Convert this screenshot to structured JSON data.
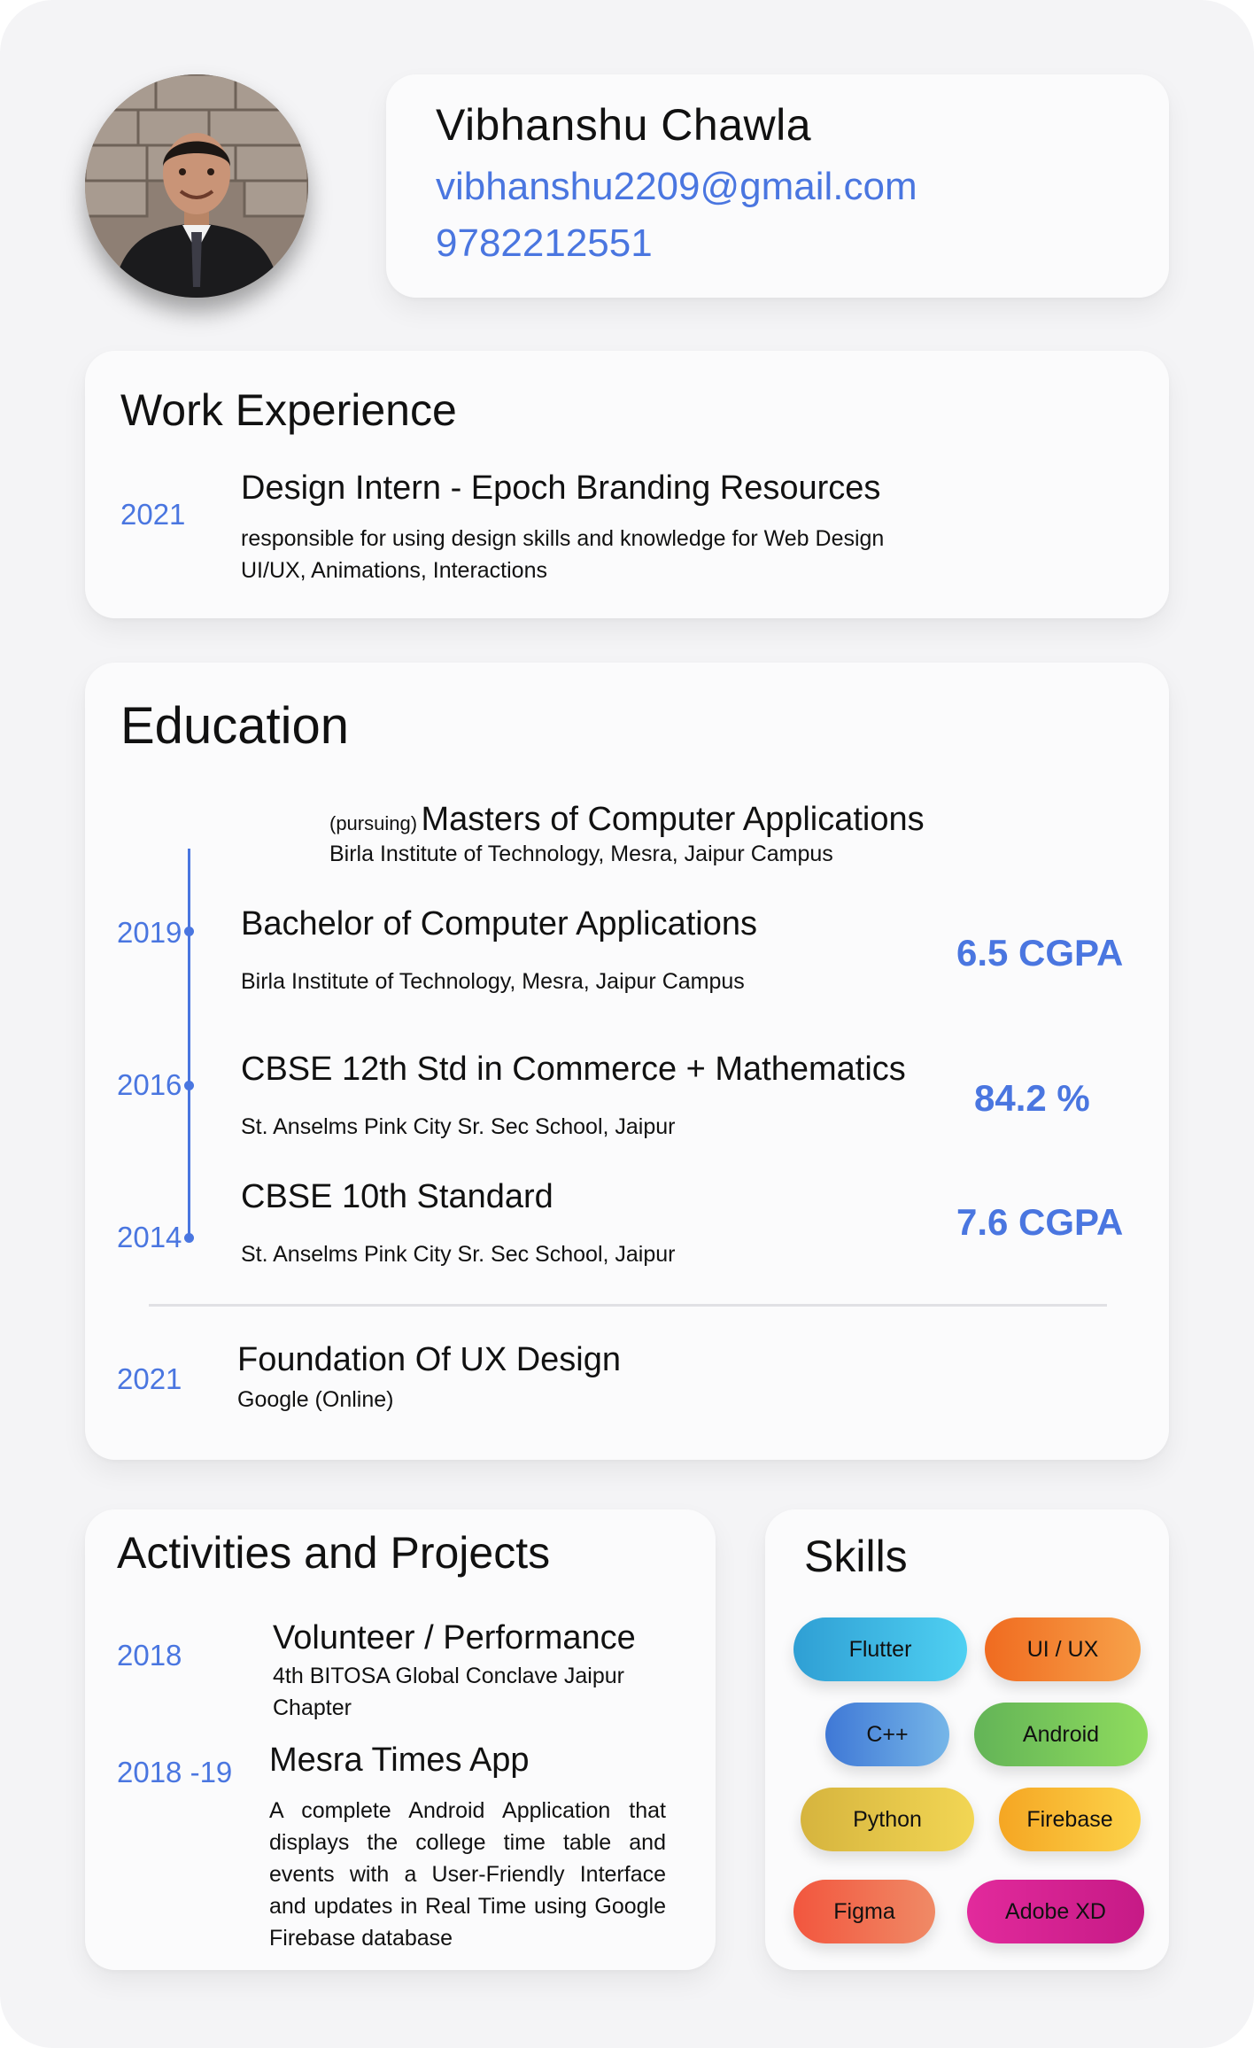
{
  "profile": {
    "name": "Vibhanshu Chawla",
    "email": "vibhanshu2209@gmail.com",
    "phone": "9782212551"
  },
  "work": {
    "title": "Work Experience",
    "items": [
      {
        "year": "2021",
        "role": "Design Intern - Epoch Branding Resources",
        "desc_line1": "responsible for using design skills and knowledge for Web Design",
        "desc_line2": "UI/UX, Animations, Interactions"
      }
    ]
  },
  "education": {
    "title": "Education",
    "pursuing": {
      "prefix": "(pursuing)",
      "degree": "Masters of Computer Applications",
      "institute": "Birla Institute of Technology, Mesra, Jaipur Campus"
    },
    "items": [
      {
        "year": "2019",
        "degree": "Bachelor of Computer Applications",
        "institute": "Birla Institute of Technology, Mesra, Jaipur Campus",
        "grade": "6.5 CGPA"
      },
      {
        "year": "2016",
        "degree": "CBSE 12th Std in Commerce + Mathematics",
        "institute": "St. Anselms Pink City Sr. Sec School, Jaipur",
        "grade": "84.2 %"
      },
      {
        "year": "2014",
        "degree": "CBSE 10th Standard",
        "institute": "St. Anselms Pink City Sr. Sec School, Jaipur",
        "grade": "7.6 CGPA"
      }
    ],
    "course": {
      "year": "2021",
      "title": "Foundation Of UX Design",
      "provider": "Google (Online)"
    }
  },
  "activities": {
    "title": "Activities and Projects",
    "items": [
      {
        "year": "2018",
        "title": "Volunteer / Performance",
        "desc": "4th BITOSA Global Conclave Jaipur Chapter"
      },
      {
        "year": "2018 -19",
        "title": "Mesra Times App",
        "desc": "A complete Android Application that displays the college time table and events with a User-Friendly Interface and updates in Real Time using Google Firebase database"
      }
    ]
  },
  "skills": {
    "title": "Skills",
    "items": [
      {
        "label": "Flutter",
        "gradient": [
          "#2f9fd4",
          "#4fd0f2"
        ]
      },
      {
        "label": "UI / UX",
        "gradient": [
          "#f06b20",
          "#f7a24a"
        ]
      },
      {
        "label": "C++",
        "gradient": [
          "#3f78d6",
          "#76b6e8"
        ]
      },
      {
        "label": "Android",
        "gradient": [
          "#63b457",
          "#8fdc5e"
        ]
      },
      {
        "label": "Python",
        "gradient": [
          "#d6b43e",
          "#f2d654"
        ]
      },
      {
        "label": "Firebase",
        "gradient": [
          "#f5a623",
          "#fcd34a"
        ]
      },
      {
        "label": "Figma",
        "gradient": [
          "#f2563e",
          "#f08a66"
        ]
      },
      {
        "label": "Adobe XD",
        "gradient": [
          "#e22a9c",
          "#c61a86"
        ]
      }
    ]
  }
}
